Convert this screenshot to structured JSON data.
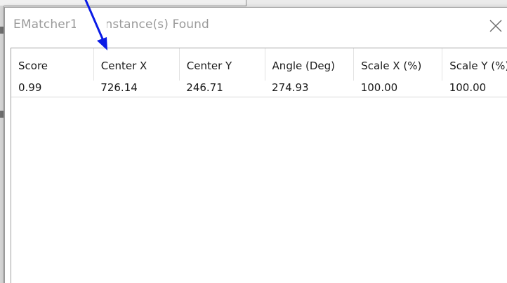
{
  "dialog": {
    "title": "EMatcher1 - 1 Instance(s) Found",
    "close_icon": "close-icon"
  },
  "table": {
    "columns": [
      "Score",
      "Center X",
      "Center Y",
      "Angle (Deg)",
      "Scale X (%)",
      "Scale Y (%)"
    ],
    "rows": [
      [
        "0.99",
        "726.14",
        "246.71",
        "274.93",
        "100.00",
        "100.00"
      ]
    ]
  },
  "annotation": {
    "arrow_color": "#0a1be6"
  }
}
